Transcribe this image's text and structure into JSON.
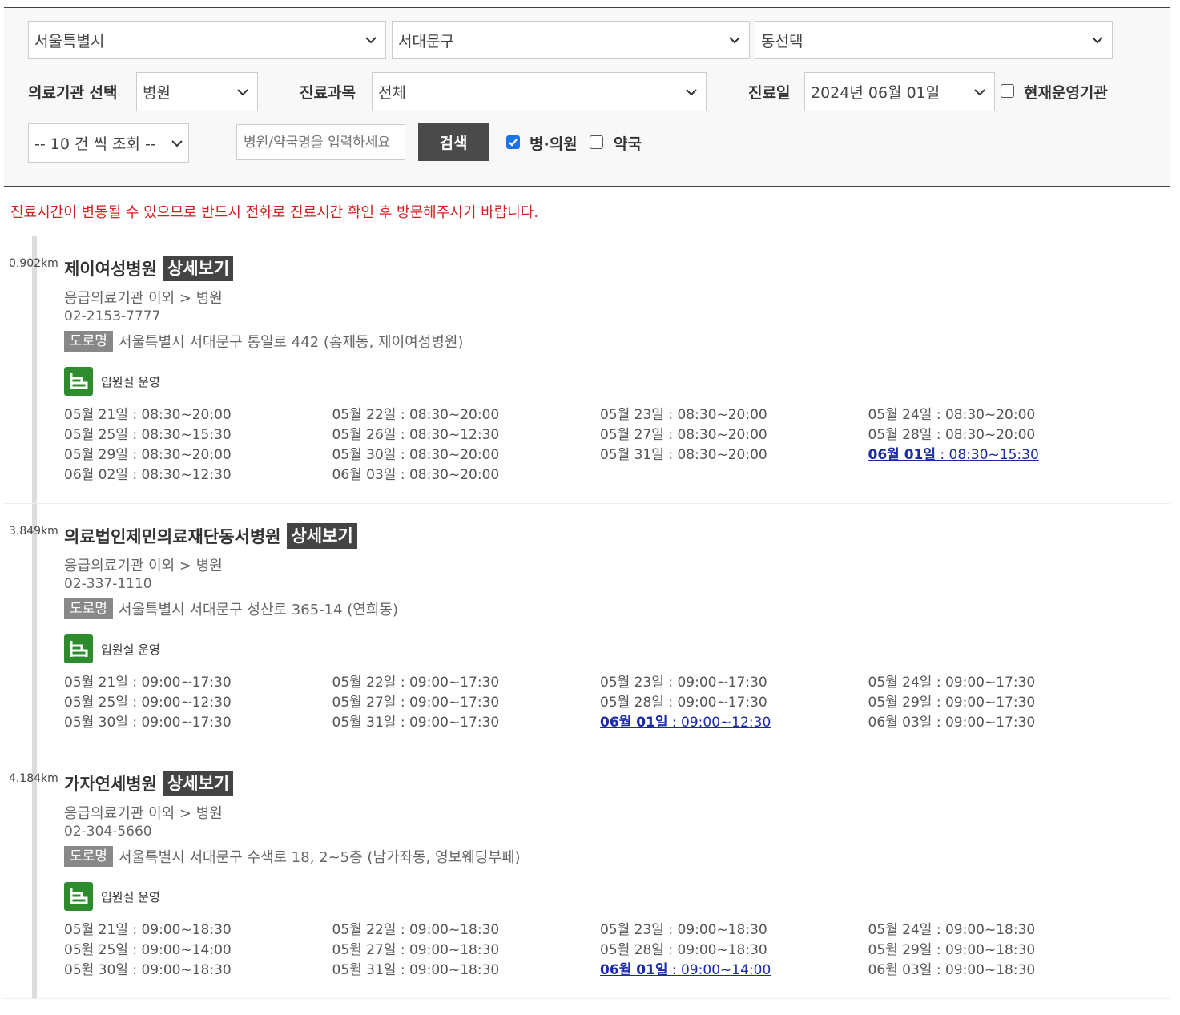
{
  "filters": {
    "city": "서울특별시",
    "district": "서대문구",
    "dong": "동선택",
    "institution_label": "의료기관 선택",
    "institution_value": "병원",
    "department_label": "진료과목",
    "department_value": "전체",
    "date_label": "진료일",
    "date_value": "2024년 06월 01일",
    "current_label": "현재운영기관",
    "page_size": "-- 10 건 씩 조회 --",
    "search_placeholder": "병원/약국명을 입력하세요",
    "search_button": "검색",
    "hospital_cb_label": "병·의원",
    "hospital_cb_checked": true,
    "pharmacy_cb_label": "약국",
    "pharmacy_cb_checked": false,
    "current_cb_checked": false
  },
  "notice": "진료시간이 변동될 수 있으므로 반드시 전화로 진료시간 확인 후 방문해주시기 바랍니다.",
  "detail_label": "상세보기",
  "road_label": "도로명",
  "colors": {
    "accent_red": "#d32020",
    "today_blue": "#1a2aa8",
    "ward_green": "#2e8b2e",
    "dark_button": "#444444"
  },
  "hospitals": [
    {
      "distance": "0.902km",
      "name": "제이여성병원",
      "category": "응급의료기관 이외 > 병원",
      "phone": "02-2153-7777",
      "address": "서울특별시 서대문구 통일로 442 (홍제동, 제이여성병원)",
      "ward_icon": "bed-icon",
      "ward": "입원실 운영",
      "schedule": [
        {
          "d": "05월 21일",
          "t": " : 08:30~20:00"
        },
        {
          "d": "05월 22일",
          "t": " : 08:30~20:00"
        },
        {
          "d": "05월 23일",
          "t": " : 08:30~20:00"
        },
        {
          "d": "05월 24일",
          "t": " : 08:30~20:00"
        },
        {
          "d": "05월 25일",
          "t": " : 08:30~15:30"
        },
        {
          "d": "05월 26일",
          "t": " : 08:30~12:30"
        },
        {
          "d": "05월 27일",
          "t": " : 08:30~20:00"
        },
        {
          "d": "05월 28일",
          "t": " : 08:30~20:00"
        },
        {
          "d": "05월 29일",
          "t": " : 08:30~20:00"
        },
        {
          "d": "05월 30일",
          "t": " : 08:30~20:00"
        },
        {
          "d": "05월 31일",
          "t": " : 08:30~20:00"
        },
        {
          "d": "06월 01일",
          "t": " : 08:30~15:30",
          "today": true
        },
        {
          "d": "06월 02일",
          "t": " : 08:30~12:30"
        },
        {
          "d": "06월 03일",
          "t": " : 08:30~20:00"
        }
      ]
    },
    {
      "distance": "3.849km",
      "name": "의료법인제민의료재단동서병원",
      "category": "응급의료기관 이외 > 병원",
      "phone": "02-337-1110",
      "address": "서울특별시 서대문구 성산로 365-14 (연희동)",
      "ward_icon": "bed-icon",
      "ward": "입원실 운영",
      "schedule": [
        {
          "d": "05월 21일",
          "t": " : 09:00~17:30"
        },
        {
          "d": "05월 22일",
          "t": " : 09:00~17:30"
        },
        {
          "d": "05월 23일",
          "t": " : 09:00~17:30"
        },
        {
          "d": "05월 24일",
          "t": " : 09:00~17:30"
        },
        {
          "d": "05월 25일",
          "t": " : 09:00~12:30"
        },
        {
          "d": "05월 27일",
          "t": " : 09:00~17:30"
        },
        {
          "d": "05월 28일",
          "t": " : 09:00~17:30"
        },
        {
          "d": "05월 29일",
          "t": " : 09:00~17:30"
        },
        {
          "d": "05월 30일",
          "t": " : 09:00~17:30"
        },
        {
          "d": "05월 31일",
          "t": " : 09:00~17:30"
        },
        {
          "d": "06월 01일",
          "t": " : 09:00~12:30",
          "today": true
        },
        {
          "d": "06월 03일",
          "t": " : 09:00~17:30"
        }
      ]
    },
    {
      "distance": "4.184km",
      "name": "가자연세병원",
      "category": "응급의료기관 이외 > 병원",
      "phone": "02-304-5660",
      "address": "서울특별시 서대문구 수색로 18, 2~5층 (남가좌동, 영보웨딩부페)",
      "ward_icon": "bed-icon",
      "ward": "입원실 운영",
      "schedule": [
        {
          "d": "05월 21일",
          "t": " : 09:00~18:30"
        },
        {
          "d": "05월 22일",
          "t": " : 09:00~18:30"
        },
        {
          "d": "05월 23일",
          "t": " : 09:00~18:30"
        },
        {
          "d": "05월 24일",
          "t": " : 09:00~18:30"
        },
        {
          "d": "05월 25일",
          "t": " : 09:00~14:00"
        },
        {
          "d": "05월 27일",
          "t": " : 09:00~18:30"
        },
        {
          "d": "05월 28일",
          "t": " : 09:00~18:30"
        },
        {
          "d": "05월 29일",
          "t": " : 09:00~18:30"
        },
        {
          "d": "05월 30일",
          "t": " : 09:00~18:30"
        },
        {
          "d": "05월 31일",
          "t": " : 09:00~18:30"
        },
        {
          "d": "06월 01일",
          "t": " : 09:00~14:00",
          "today": true
        },
        {
          "d": "06월 03일",
          "t": " : 09:00~18:30"
        }
      ]
    }
  ]
}
